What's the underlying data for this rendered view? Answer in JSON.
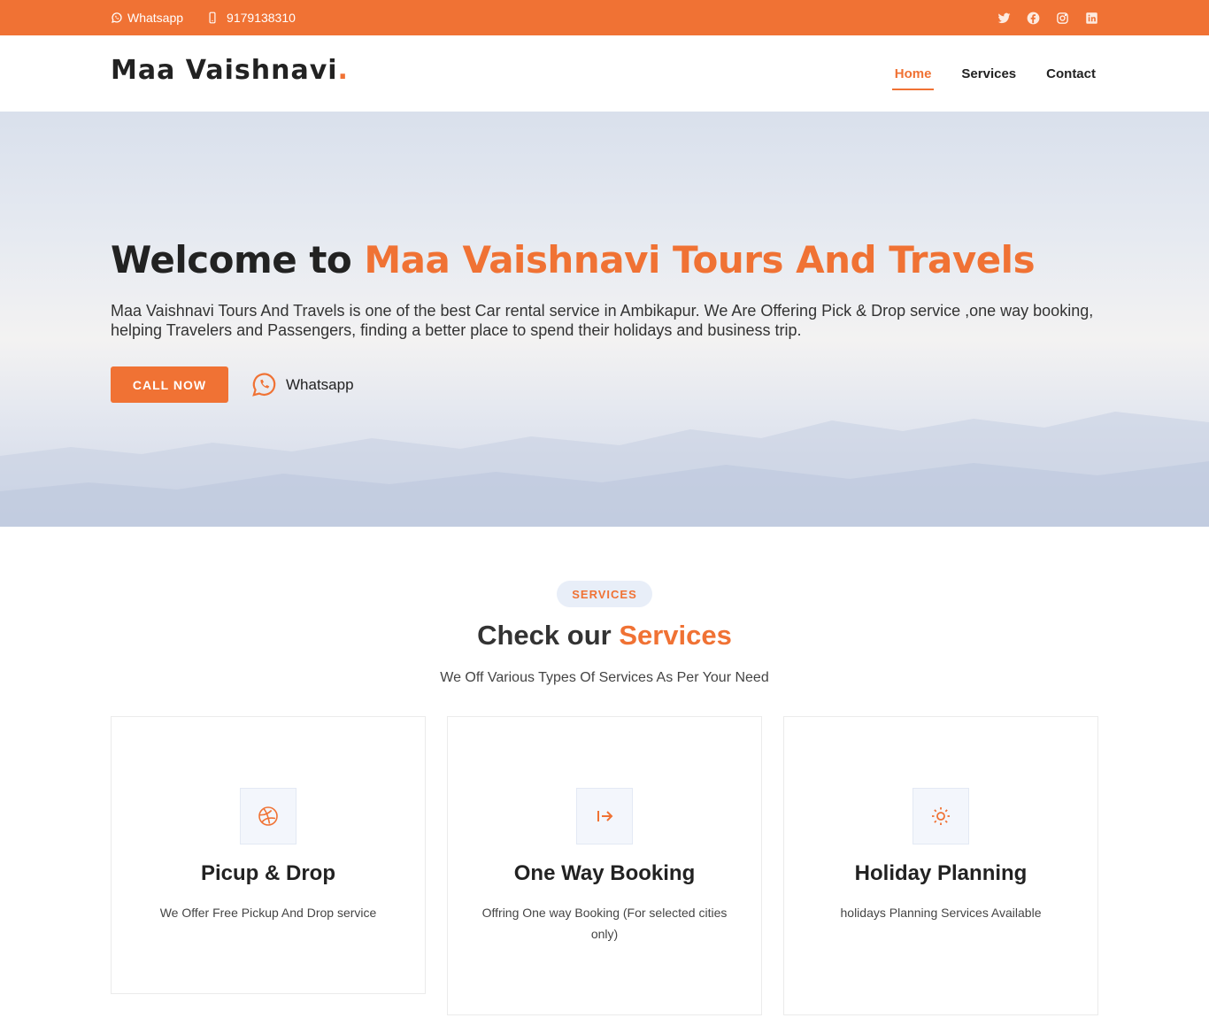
{
  "topbar": {
    "whatsapp_label": "Whatsapp",
    "phone": "9179138310",
    "social_icons": [
      "twitter-icon",
      "facebook-icon",
      "instagram-icon",
      "linkedin-icon"
    ]
  },
  "header": {
    "logo_text": "Maa Vaishnavi",
    "logo_dot": ".",
    "nav": [
      {
        "label": "Home",
        "active": true
      },
      {
        "label": "Services",
        "active": false
      },
      {
        "label": "Contact",
        "active": false
      }
    ]
  },
  "hero": {
    "title_prefix": "Welcome to ",
    "title_highlight": "Maa Vaishnavi Tours And Travels",
    "description": "Maa Vaishnavi Tours And Travels is one of the best Car rental service in Ambikapur. We Are Offering Pick & Drop service ,one way booking, helping Travelers and Passengers, finding a better place to spend their holidays and business trip.",
    "call_button": "CALL NOW",
    "whatsapp_button": "Whatsapp"
  },
  "services": {
    "badge": "SERVICES",
    "title_prefix": "Check our ",
    "title_highlight": "Services",
    "subtitle": "We Off Various Types Of Services As Per Your Need",
    "cards": [
      {
        "icon": "dribbble-icon",
        "title": "Picup & Drop",
        "text": "We Offer Free Pickup And Drop service"
      },
      {
        "icon": "arrow-right-icon",
        "title": "One Way Booking",
        "text": "Offring One way Booking (For selected cities only)"
      },
      {
        "icon": "sun-icon",
        "title": "Holiday Planning",
        "text": "holidays Planning Services Available"
      }
    ]
  },
  "colors": {
    "accent": "#f07234",
    "heading": "#222222",
    "badge_bg": "#e8eef8"
  }
}
